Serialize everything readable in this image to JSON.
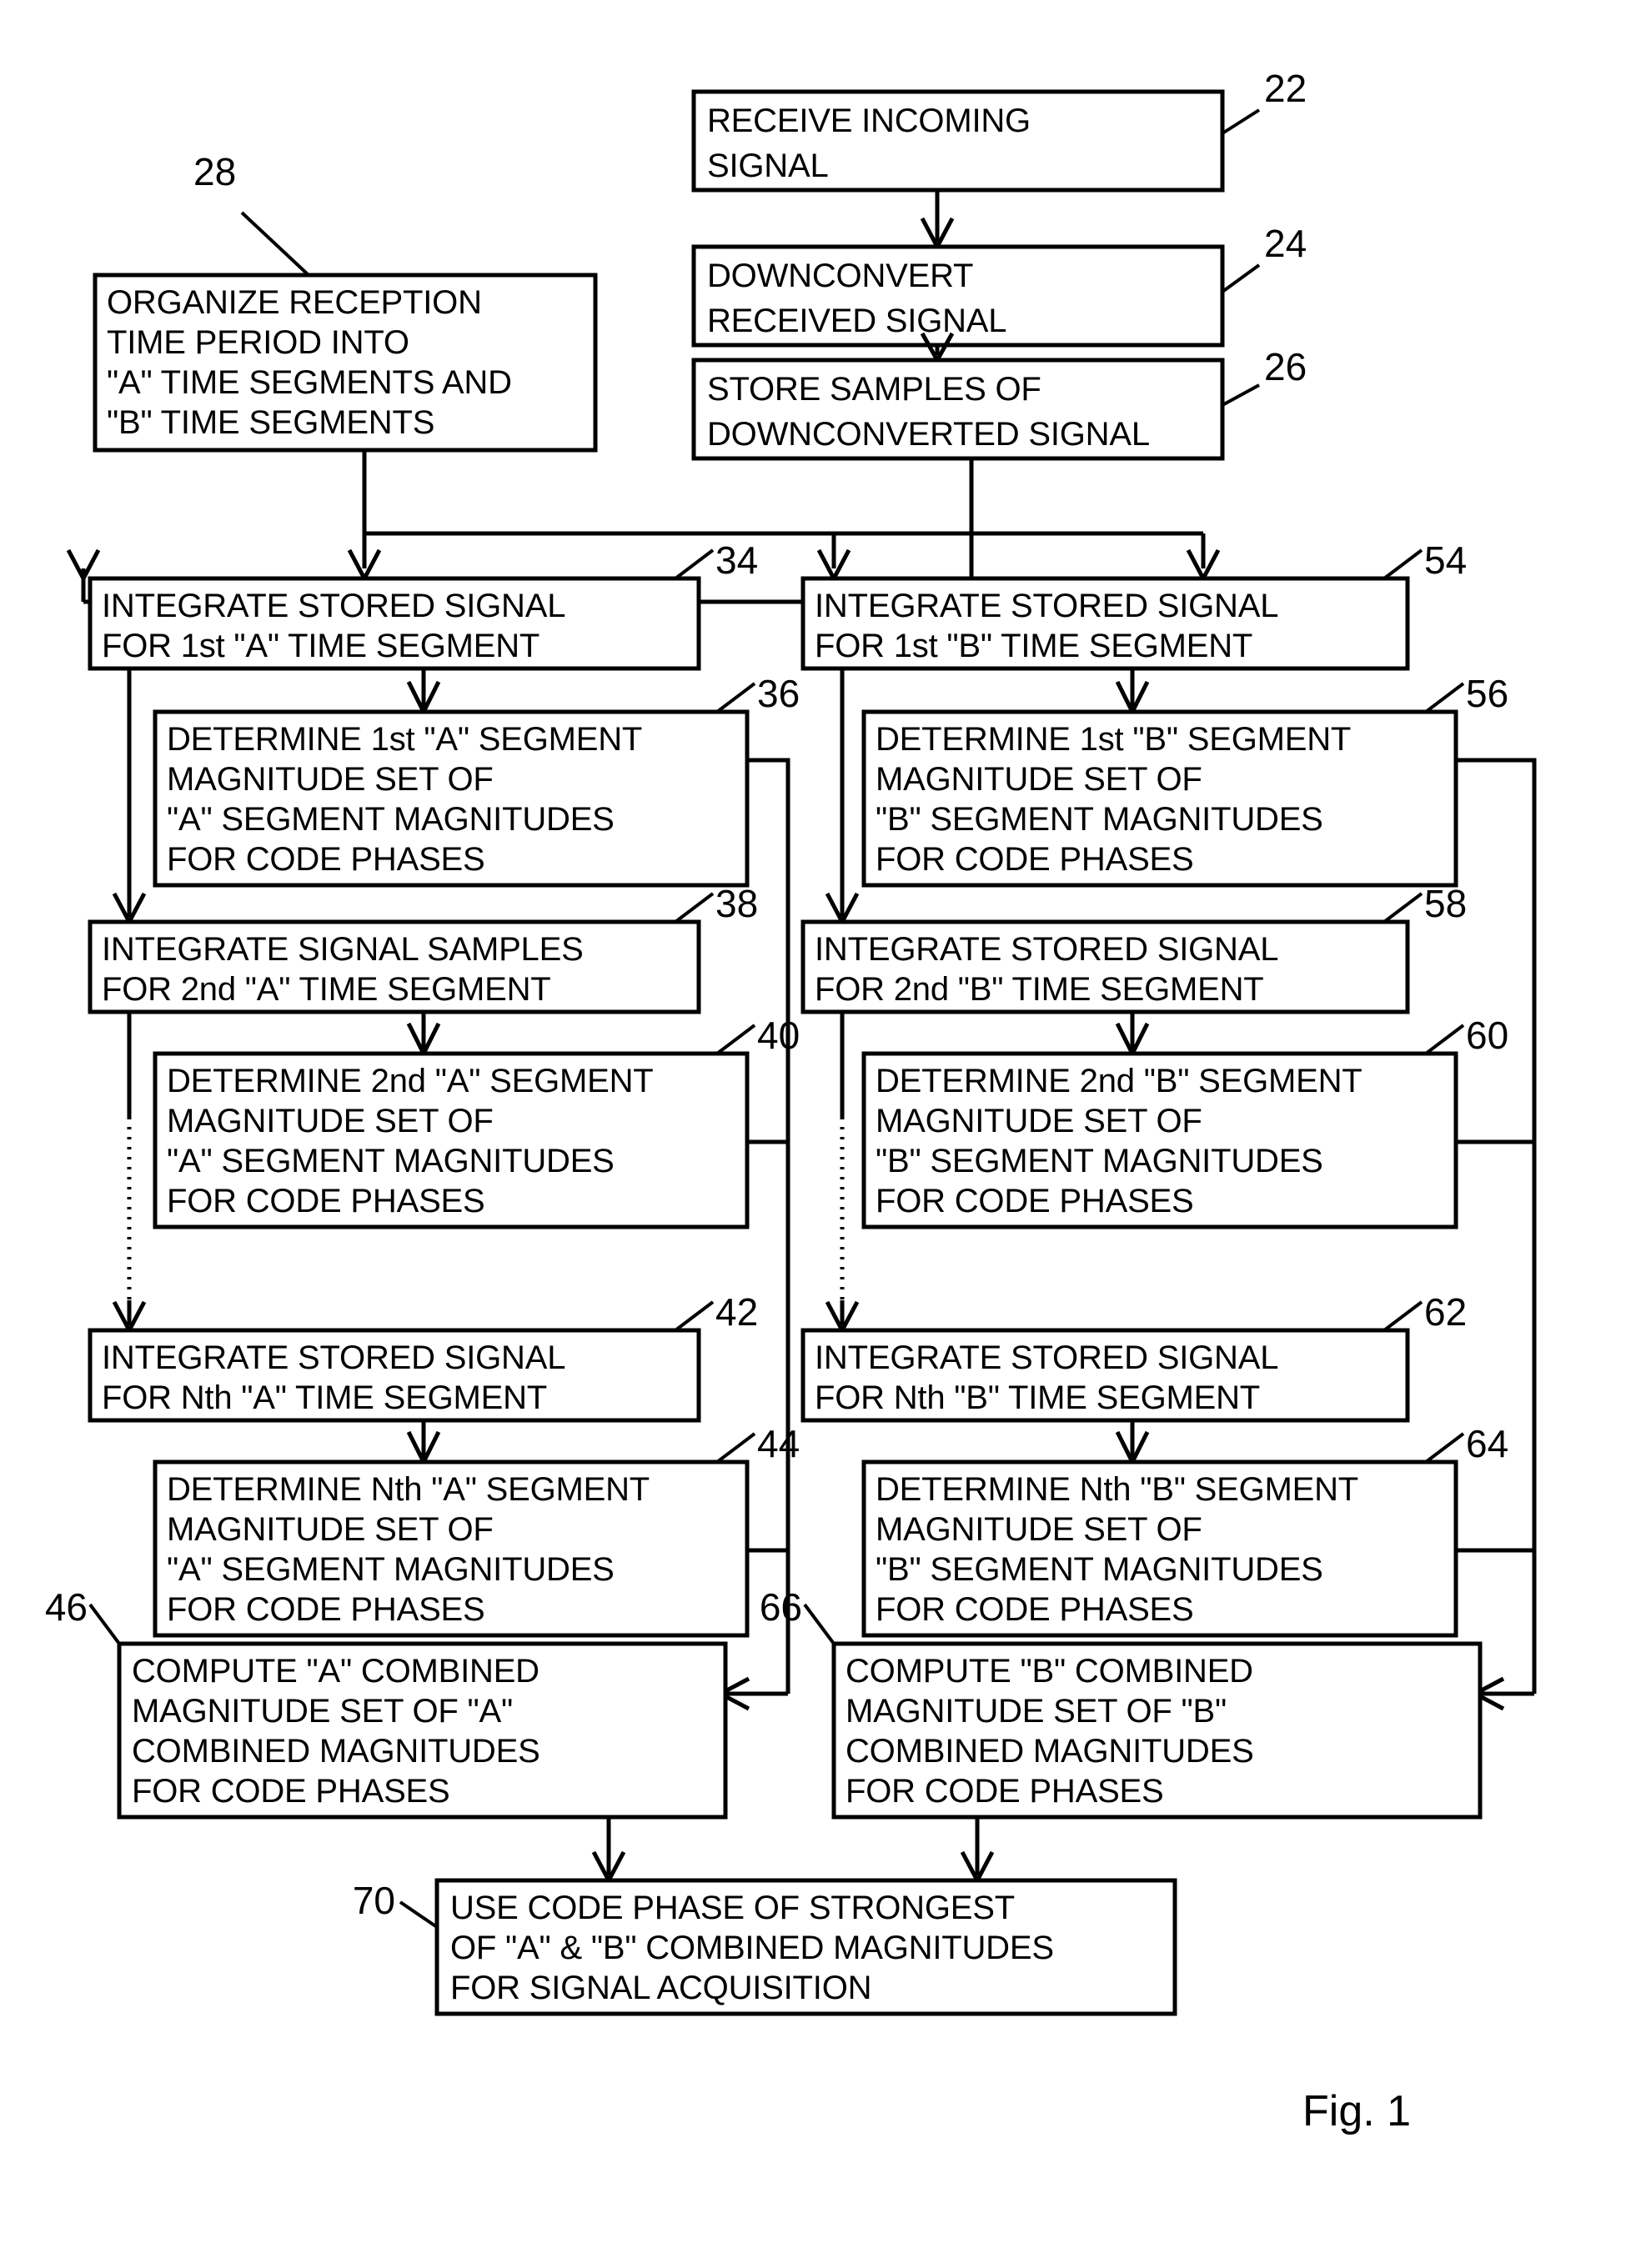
{
  "figure": {
    "label": "Fig.  1",
    "title_blocks": {
      "b22": {
        "ref": "22",
        "lines": [
          "RECEIVE INCOMING",
          "SIGNAL"
        ]
      },
      "b24": {
        "ref": "24",
        "lines": [
          "DOWNCONVERT",
          "RECEIVED SIGNAL"
        ]
      },
      "b26": {
        "ref": "26",
        "lines": [
          "STORE SAMPLES OF",
          "DOWNCONVERTED SIGNAL"
        ]
      },
      "b28": {
        "ref": "28",
        "lines": [
          "ORGANIZE RECEPTION",
          "TIME PERIOD INTO",
          "\"A\" TIME SEGMENTS AND",
          "\"B\" TIME SEGMENTS"
        ]
      },
      "b34": {
        "ref": "34",
        "lines": [
          "INTEGRATE STORED SIGNAL",
          "FOR 1st \"A\" TIME SEGMENT"
        ]
      },
      "b36": {
        "ref": "36",
        "lines": [
          "DETERMINE 1st \"A\" SEGMENT",
          "MAGNITUDE SET OF",
          "\"A\" SEGMENT MAGNITUDES",
          "FOR CODE PHASES"
        ]
      },
      "b38": {
        "ref": "38",
        "lines": [
          "INTEGRATE SIGNAL SAMPLES",
          "FOR 2nd \"A\" TIME SEGMENT"
        ]
      },
      "b40": {
        "ref": "40",
        "lines": [
          "DETERMINE 2nd \"A\" SEGMENT",
          "MAGNITUDE SET OF",
          "\"A\" SEGMENT MAGNITUDES",
          "FOR CODE PHASES"
        ]
      },
      "b42": {
        "ref": "42",
        "lines": [
          "INTEGRATE STORED SIGNAL",
          "FOR Nth \"A\" TIME SEGMENT"
        ]
      },
      "b44": {
        "ref": "44",
        "lines": [
          "DETERMINE Nth \"A\" SEGMENT",
          "MAGNITUDE SET OF",
          "\"A\"  SEGMENT MAGNITUDES",
          "FOR CODE PHASES"
        ]
      },
      "b46": {
        "ref": "46",
        "lines": [
          "COMPUTE \"A\" COMBINED",
          "MAGNITUDE SET OF \"A\"",
          "COMBINED MAGNITUDES",
          "FOR CODE PHASES"
        ]
      },
      "b54": {
        "ref": "54",
        "lines": [
          "INTEGRATE STORED SIGNAL",
          "FOR 1st \"B\" TIME SEGMENT"
        ]
      },
      "b56": {
        "ref": "56",
        "lines": [
          "DETERMINE 1st \"B\" SEGMENT",
          "MAGNITUDE SET OF",
          "\"B\" SEGMENT MAGNITUDES",
          "FOR CODE PHASES"
        ]
      },
      "b58": {
        "ref": "58",
        "lines": [
          "INTEGRATE STORED SIGNAL",
          "FOR 2nd \"B\" TIME SEGMENT"
        ]
      },
      "b60": {
        "ref": "60",
        "lines": [
          "DETERMINE 2nd \"B\" SEGMENT",
          "MAGNITUDE SET OF",
          "\"B\" SEGMENT MAGNITUDES",
          "FOR CODE PHASES"
        ]
      },
      "b62": {
        "ref": "62",
        "lines": [
          "INTEGRATE STORED SIGNAL",
          "FOR Nth \"B\" TIME SEGMENT"
        ]
      },
      "b64": {
        "ref": "64",
        "lines": [
          "DETERMINE Nth \"B\" SEGMENT",
          "MAGNITUDE SET OF",
          "\"B\" SEGMENT MAGNITUDES",
          "FOR CODE PHASES"
        ]
      },
      "b66": {
        "ref": "66",
        "lines": [
          "COMPUTE \"B\" COMBINED",
          "MAGNITUDE SET OF \"B\"",
          "COMBINED MAGNITUDES",
          "FOR CODE PHASES"
        ]
      },
      "b70": {
        "ref": "70",
        "lines": [
          "USE CODE PHASE OF STRONGEST",
          "OF \"A\" & \"B\" COMBINED MAGNITUDES",
          "FOR SIGNAL ACQUISITION"
        ]
      }
    }
  }
}
